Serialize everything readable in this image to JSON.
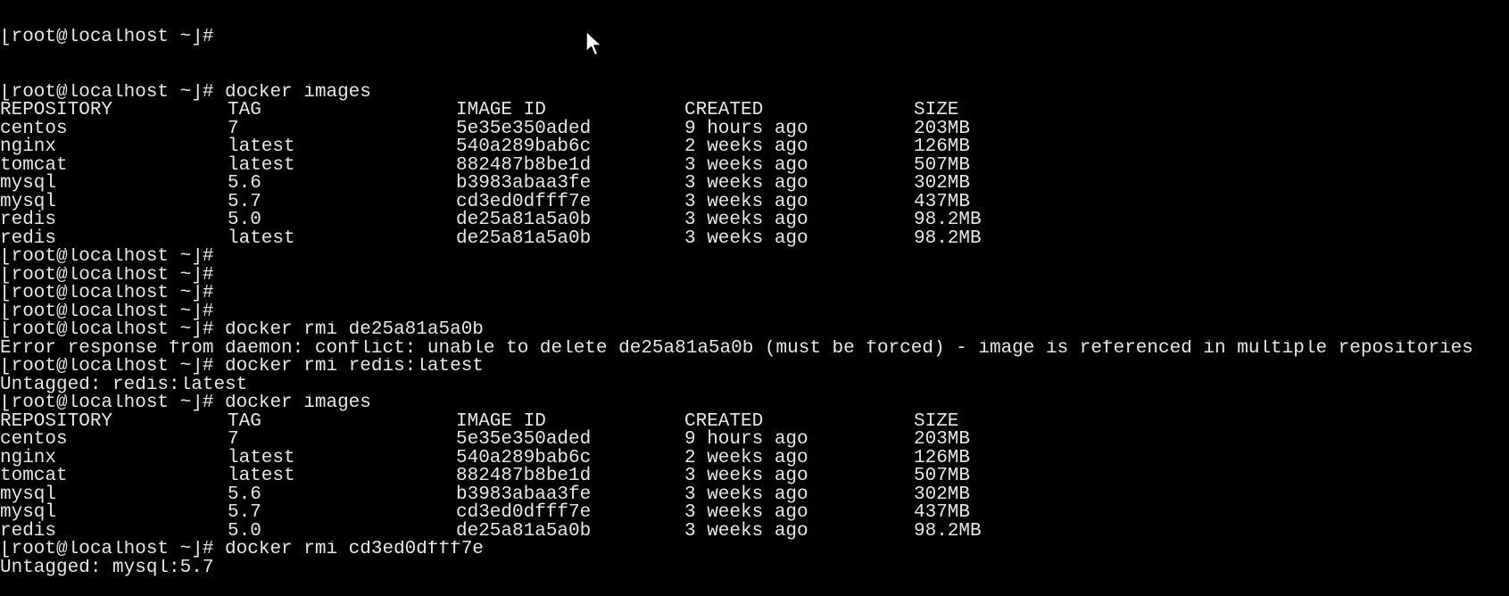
{
  "terminal": {
    "partial_top_line": "[root@localhost ~]#",
    "blocks": [
      {
        "type": "command",
        "prompt": "[root@localhost ~]# ",
        "command": "docker images"
      },
      {
        "type": "table",
        "columns": [
          "REPOSITORY",
          "TAG",
          "IMAGE ID",
          "CREATED",
          "SIZE"
        ],
        "rows": [
          [
            "centos",
            "7",
            "5e35e350aded",
            "9 hours ago",
            "203MB"
          ],
          [
            "nginx",
            "latest",
            "540a289bab6c",
            "2 weeks ago",
            "126MB"
          ],
          [
            "tomcat",
            "latest",
            "882487b8be1d",
            "3 weeks ago",
            "507MB"
          ],
          [
            "mysql",
            "5.6",
            "b3983abaa3fe",
            "3 weeks ago",
            "302MB"
          ],
          [
            "mysql",
            "5.7",
            "cd3ed0dfff7e",
            "3 weeks ago",
            "437MB"
          ],
          [
            "redis",
            "5.0",
            "de25a81a5a0b",
            "3 weeks ago",
            "98.2MB"
          ],
          [
            "redis",
            "latest",
            "de25a81a5a0b",
            "3 weeks ago",
            "98.2MB"
          ]
        ]
      },
      {
        "type": "command",
        "prompt": "[root@localhost ~]#",
        "command": ""
      },
      {
        "type": "command",
        "prompt": "[root@localhost ~]#",
        "command": ""
      },
      {
        "type": "command",
        "prompt": "[root@localhost ~]#",
        "command": ""
      },
      {
        "type": "command",
        "prompt": "[root@localhost ~]#",
        "command": ""
      },
      {
        "type": "command",
        "prompt": "[root@localhost ~]# ",
        "command": "docker rmi de25a81a5a0b"
      },
      {
        "type": "output",
        "text": "Error response from daemon: conflict: unable to delete de25a81a5a0b (must be forced) - image is referenced in multiple repositories"
      },
      {
        "type": "command",
        "prompt": "[root@localhost ~]# ",
        "command": "docker rmi redis:latest"
      },
      {
        "type": "output",
        "text": "Untagged: redis:latest"
      },
      {
        "type": "command",
        "prompt": "[root@localhost ~]# ",
        "command": "docker images"
      },
      {
        "type": "table",
        "columns": [
          "REPOSITORY",
          "TAG",
          "IMAGE ID",
          "CREATED",
          "SIZE"
        ],
        "rows": [
          [
            "centos",
            "7",
            "5e35e350aded",
            "9 hours ago",
            "203MB"
          ],
          [
            "nginx",
            "latest",
            "540a289bab6c",
            "2 weeks ago",
            "126MB"
          ],
          [
            "tomcat",
            "latest",
            "882487b8be1d",
            "3 weeks ago",
            "507MB"
          ],
          [
            "mysql",
            "5.6",
            "b3983abaa3fe",
            "3 weeks ago",
            "302MB"
          ],
          [
            "mysql",
            "5.7",
            "cd3ed0dfff7e",
            "3 weeks ago",
            "437MB"
          ],
          [
            "redis",
            "5.0",
            "de25a81a5a0b",
            "3 weeks ago",
            "98.2MB"
          ]
        ]
      },
      {
        "type": "command",
        "prompt": "[root@localhost ~]# ",
        "command": "docker rmi cd3ed0dfff7e"
      },
      {
        "type": "output",
        "text": "Untagged: mysql:5.7"
      }
    ]
  },
  "colors": {
    "background": "#000000",
    "foreground": "#e6e6e6"
  },
  "icons": {
    "mouse_cursor": "arrow-cursor-icon"
  }
}
